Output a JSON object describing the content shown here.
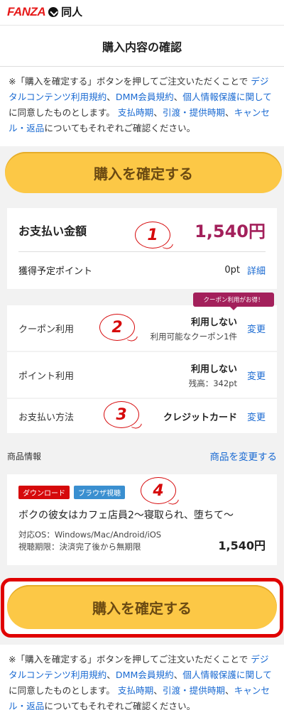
{
  "logo": {
    "brand": "FANZA",
    "sub": "同人"
  },
  "header": {
    "title": "購入内容の確認"
  },
  "notice": {
    "prefix": "※「購入を確定する」ボタンを押してご注文いただくことで",
    "link1": "デジタルコンテンツ利用規約",
    "sep1": "、",
    "link2": "DMM会員規約",
    "sep2": "、",
    "link3": "個人情報保護に関して",
    "mid": "に同意したものとします。",
    "link4": "支払時期",
    "sep3": "、",
    "link5": "引渡・提供時期",
    "sep4": "、",
    "link6": "キャンセル・返品",
    "suffix": "についてもそれぞれご確認ください。"
  },
  "buttons": {
    "confirm": "購入を確定する"
  },
  "payment": {
    "label": "お支払い金額",
    "amount": "1,540円",
    "points_label": "獲得予定ポイント",
    "points_value": "0pt",
    "points_link": "詳細"
  },
  "coupon_badge": "クーポン利用がお得！",
  "options": {
    "coupon": {
      "label": "クーポン利用",
      "value": "利用しない",
      "sub": "利用可能なクーポン1件",
      "link": "変更"
    },
    "point": {
      "label": "ポイント利用",
      "value": "利用しない",
      "sub": "残高：342pt",
      "link": "変更"
    },
    "method": {
      "label": "お支払い方法",
      "value": "クレジットカード",
      "link": "変更"
    }
  },
  "product_section": {
    "title": "商品情報",
    "change_link": "商品を変更する"
  },
  "product": {
    "tags": [
      "ダウンロード",
      "ブラウザ視聴"
    ],
    "title": "ボクの彼女はカフェ店員2〜寝取られ、堕ちて〜",
    "os": "対応OS：Windows/Mac/Android/iOS",
    "period": "視聴期限：決済完了後から無期限",
    "price": "1,540円"
  },
  "callouts": [
    "1",
    "2",
    "3",
    "4"
  ]
}
